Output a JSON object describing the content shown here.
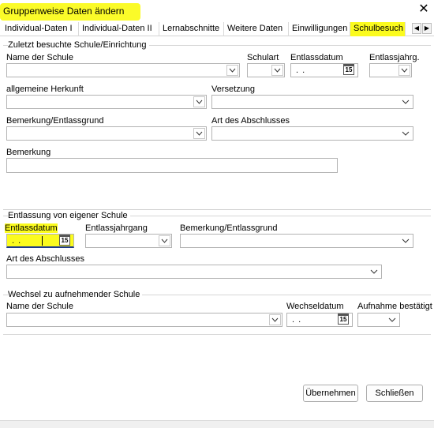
{
  "window": {
    "title": "Gruppenweise Daten ändern",
    "close_glyph": "✕"
  },
  "tabs": [
    "Individual-Daten I",
    "Individual-Daten II",
    "Lernabschnitte",
    "Weitere Daten",
    "Einwilligungen",
    "Schulbesuch"
  ],
  "active_tab": "Schulbesuch",
  "section_prev": {
    "title": "Zuletzt besuchte Schule/Einrichtung",
    "name_label": "Name der Schule",
    "schulart_label": "Schulart",
    "entlassdatum_label": "Entlassdatum",
    "entlassdatum_value": ". .",
    "entlassjahrg_label": "Entlassjahrg.",
    "herkunft_label": "allgemeine Herkunft",
    "versetzung_label": "Versetzung",
    "bemerkung_grund_label": "Bemerkung/Entlassgrund",
    "abschluss_label": "Art des Abschlusses",
    "bemerkung_label": "Bemerkung"
  },
  "section_own": {
    "title": "Entlassung von eigener Schule",
    "entlassdatum_label": "Entlassdatum",
    "entlassdatum_value": ". .",
    "entlassjahrgang_label": "Entlassjahrgang",
    "bemerkung_grund_label": "Bemerkung/Entlassgrund",
    "abschluss_label": "Art des Abschlusses"
  },
  "section_next": {
    "title": "Wechsel zu aufnehmender Schule",
    "name_label": "Name der Schule",
    "wechseldatum_label": "Wechseldatum",
    "wechseldatum_value": ". .",
    "aufnahme_label": "Aufnahme bestätigt"
  },
  "buttons": {
    "apply": "Übernehmen",
    "close": "Schließen"
  },
  "icons": {
    "calendar": "15"
  },
  "colors": {
    "highlight": "#fbfb1e",
    "border": "#b3b3b3"
  }
}
